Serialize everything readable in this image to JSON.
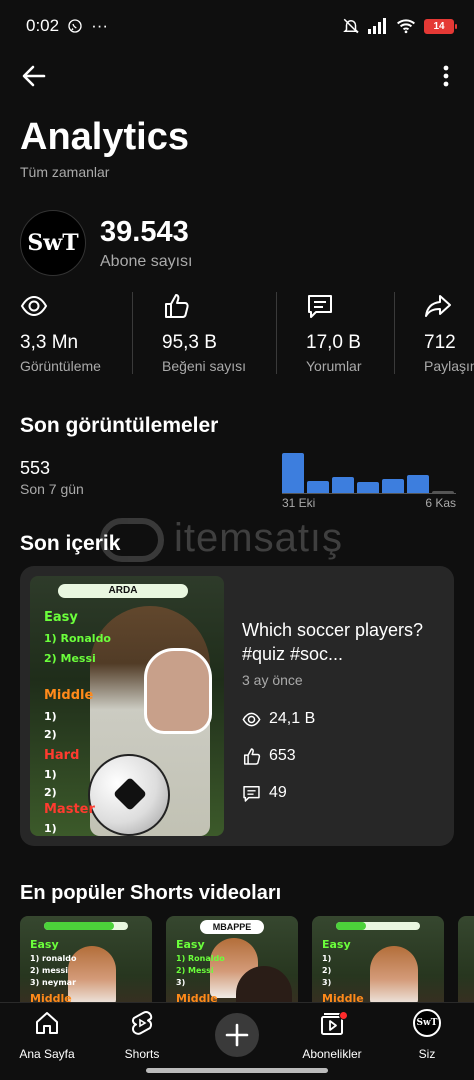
{
  "status_bar": {
    "time": "0:02",
    "dots": "···",
    "battery": "14"
  },
  "header": {
    "title": "Analytics",
    "subtitle": "Tüm zamanlar"
  },
  "channel": {
    "avatar_text": "SwT",
    "subscribers": "39.543",
    "subscribers_label": "Abone sayısı"
  },
  "stats": [
    {
      "value": "3,3 Mn",
      "label": "Görüntüleme",
      "icon": "eye-icon"
    },
    {
      "value": "95,3 B",
      "label": "Beğeni sayısı",
      "icon": "thumbs-up-icon"
    },
    {
      "value": "17,0 B",
      "label": "Yorumlar",
      "icon": "comment-icon"
    },
    {
      "value": "712",
      "label": "Paylaşım",
      "icon": "share-icon"
    }
  ],
  "recent_views": {
    "title": "Son görüntülemeler",
    "count": "553",
    "period": "Son 7 gün",
    "chart_data": {
      "type": "bar",
      "values": [
        100,
        30,
        40,
        28,
        36,
        44,
        6
      ],
      "x_start_label": "31 Eki",
      "x_end_label": "6 Kas",
      "bar_color": "#3d7ede"
    }
  },
  "watermark": {
    "text": "itemsatış"
  },
  "recent_content": {
    "title": "Son içerik",
    "thumbnail": {
      "tag": "ARDA",
      "lines": [
        "Easy",
        "1) Ronaldo",
        "2) Messi",
        "Middle",
        "1)",
        "2)",
        "Hard",
        "1)",
        "2)",
        "Master",
        "1)"
      ]
    },
    "video_title": "Which soccer players? #quiz #soc...",
    "age": "3 ay önce",
    "views": "24,1 B",
    "likes": "653",
    "comments": "49"
  },
  "top_shorts": {
    "title": "En popüler Shorts videoları",
    "items": [
      {
        "tag": "",
        "lines": [
          "Easy",
          "1) ronaldo",
          "2) messi",
          "3) neymar",
          "Middle"
        ]
      },
      {
        "tag": "MBAPPE",
        "lines": [
          "Easy",
          "1) Ronaldo",
          "2) Messi",
          "3)",
          "Middle"
        ]
      },
      {
        "tag": "",
        "lines": [
          "Easy",
          "1)",
          "2)",
          "3)",
          "Middle"
        ]
      }
    ]
  },
  "bottom_nav": [
    {
      "label": "Ana Sayfa",
      "icon": "home-icon"
    },
    {
      "label": "Shorts",
      "icon": "shorts-icon"
    },
    {
      "label": "",
      "icon": "plus-icon"
    },
    {
      "label": "Abonelikler",
      "icon": "subscriptions-icon"
    },
    {
      "label": "Siz",
      "icon": "avatar-icon"
    }
  ],
  "colors": {
    "background": "#0f0f0f",
    "card": "#272727",
    "accent_blue": "#3d7ede",
    "muted_text": "#aaaaaa"
  }
}
